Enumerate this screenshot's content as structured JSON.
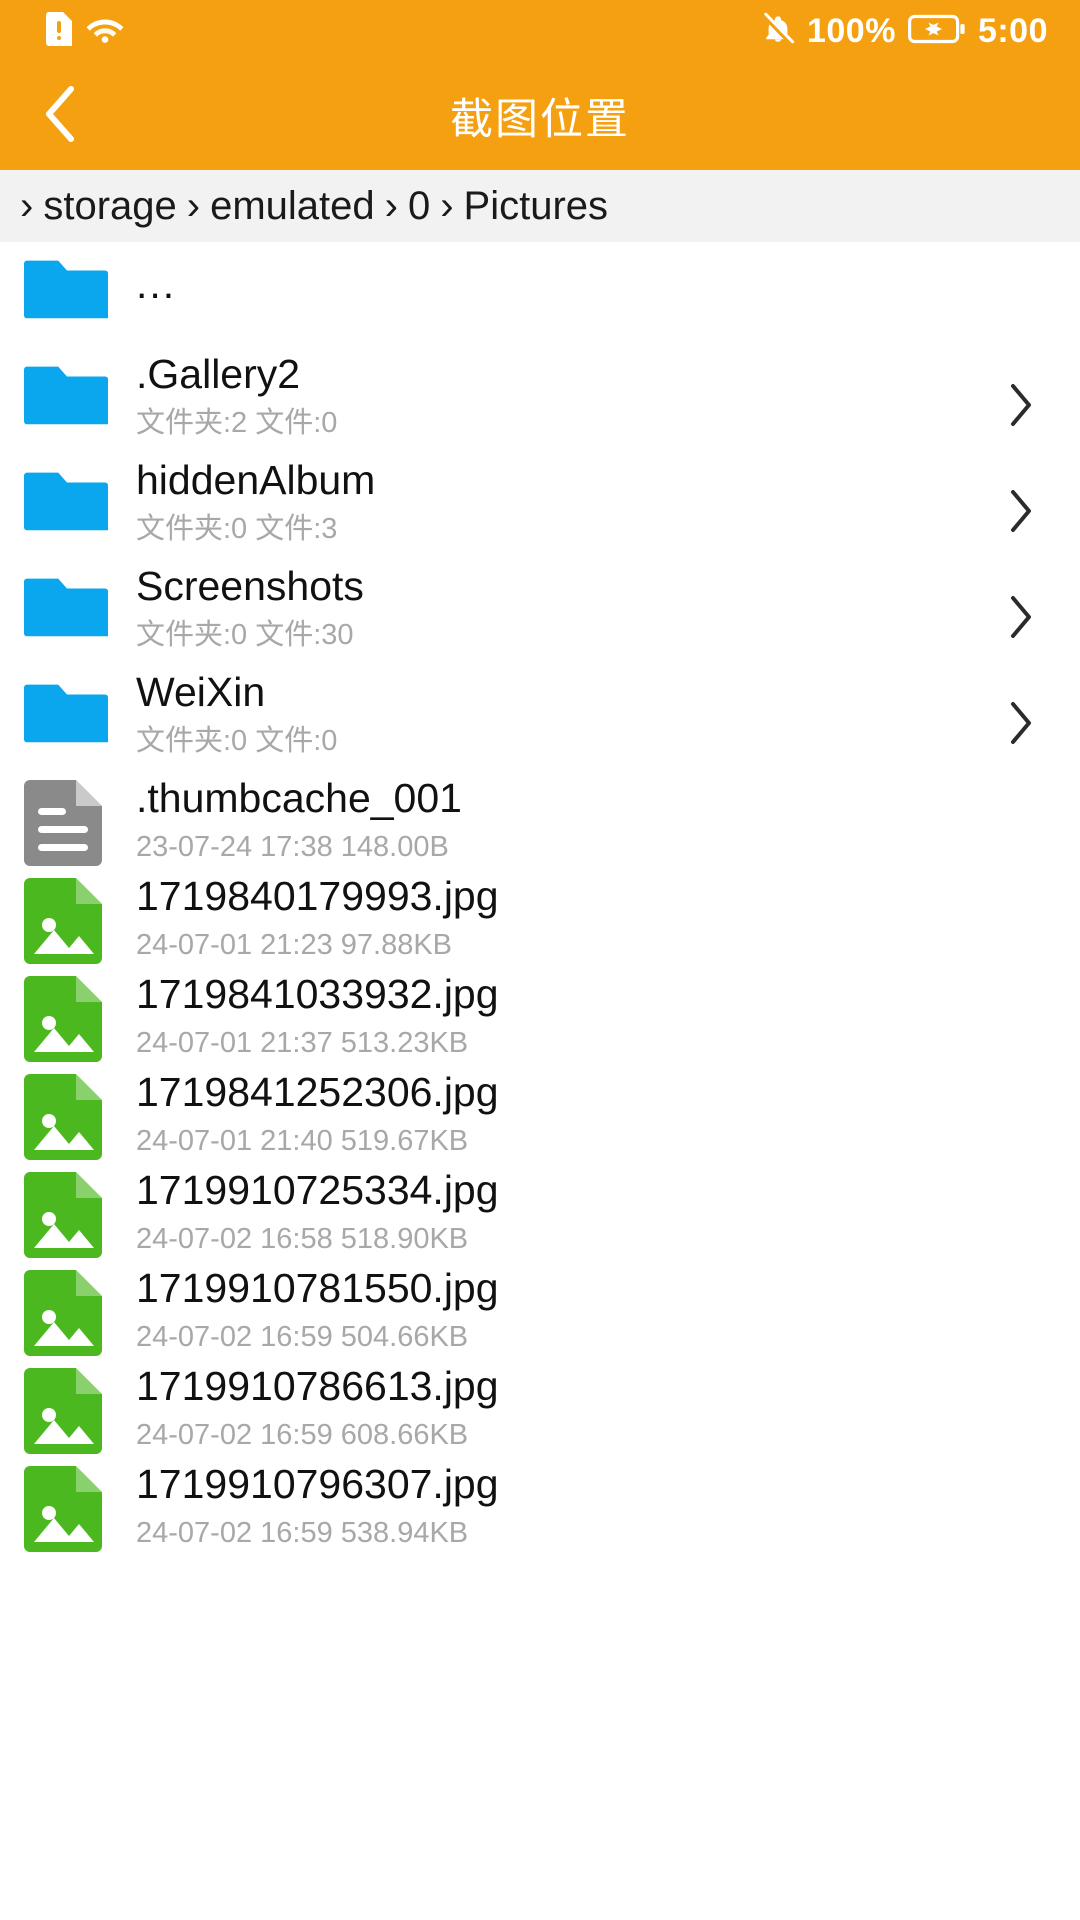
{
  "statusbar": {
    "icons_left": [
      "sim-warning-icon",
      "wifi-icon"
    ],
    "mute_icon": "bell-muted-icon",
    "battery_percent": "100%",
    "battery_icon": "battery-charging-icon",
    "time": "5:00",
    "background_color": "#f5a011"
  },
  "appbar": {
    "back_icon": "back-chevron-icon",
    "title": "截图位置",
    "background_color": "#f5a011"
  },
  "breadcrumb": {
    "separator": "›",
    "segments": [
      "storage",
      "emulated",
      "0",
      "Pictures"
    ]
  },
  "colors": {
    "folder_blue": "#0aa6ee",
    "image_green": "#4cb820",
    "doc_gray": "#8a8a8a",
    "subtitle_gray": "#a8a8a8",
    "accent": "#f5a011"
  },
  "list": {
    "items": [
      {
        "kind": "parent",
        "icon": "folder-icon",
        "name": "...",
        "subtitle": "",
        "chevron": false
      },
      {
        "kind": "folder",
        "icon": "folder-icon",
        "name": ".Gallery2",
        "subtitle": "文件夹:2 文件:0",
        "chevron": true
      },
      {
        "kind": "folder",
        "icon": "folder-icon",
        "name": "hiddenAlbum",
        "subtitle": "文件夹:0 文件:3",
        "chevron": true
      },
      {
        "kind": "folder",
        "icon": "folder-icon",
        "name": "Screenshots",
        "subtitle": "文件夹:0 文件:30",
        "chevron": true
      },
      {
        "kind": "folder",
        "icon": "folder-icon",
        "name": "WeiXin",
        "subtitle": "文件夹:0 文件:0",
        "chevron": true
      },
      {
        "kind": "file-doc",
        "icon": "document-icon",
        "name": ".thumbcache_001",
        "subtitle": "23-07-24 17:38  148.00B",
        "chevron": false
      },
      {
        "kind": "file-image",
        "icon": "image-file-icon",
        "name": "1719840179993.jpg",
        "subtitle": "24-07-01 21:23  97.88KB",
        "chevron": false
      },
      {
        "kind": "file-image",
        "icon": "image-file-icon",
        "name": "1719841033932.jpg",
        "subtitle": "24-07-01 21:37  513.23KB",
        "chevron": false
      },
      {
        "kind": "file-image",
        "icon": "image-file-icon",
        "name": "1719841252306.jpg",
        "subtitle": "24-07-01 21:40  519.67KB",
        "chevron": false
      },
      {
        "kind": "file-image",
        "icon": "image-file-icon",
        "name": "1719910725334.jpg",
        "subtitle": "24-07-02 16:58  518.90KB",
        "chevron": false
      },
      {
        "kind": "file-image",
        "icon": "image-file-icon",
        "name": "1719910781550.jpg",
        "subtitle": "24-07-02 16:59  504.66KB",
        "chevron": false
      },
      {
        "kind": "file-image",
        "icon": "image-file-icon",
        "name": "1719910786613.jpg",
        "subtitle": "24-07-02 16:59  608.66KB",
        "chevron": false
      },
      {
        "kind": "file-image",
        "icon": "image-file-icon",
        "name": "1719910796307.jpg",
        "subtitle": "24-07-02 16:59  538.94KB",
        "chevron": false
      }
    ]
  }
}
